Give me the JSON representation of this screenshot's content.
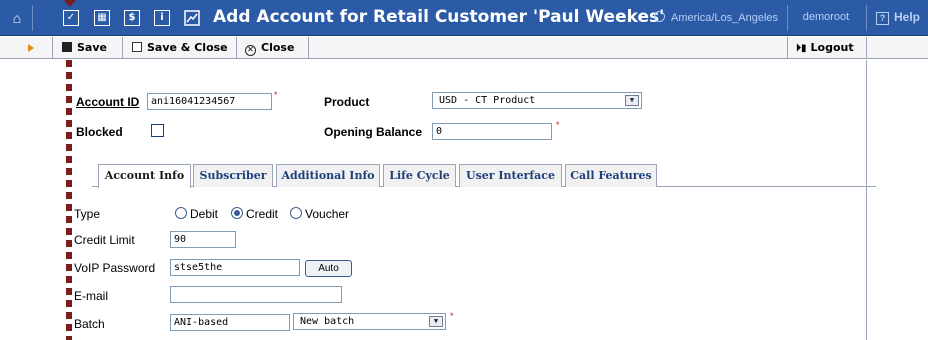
{
  "header": {
    "title": "Add Account for Retail Customer 'Paul Weekes'",
    "timezone": "America/Los_Angeles",
    "user": "demoroot",
    "help_label": "Help",
    "help_glyph": "?",
    "icons": [
      "home-icon",
      "checkbox-icon",
      "grid-icon",
      "dollar-icon",
      "info-icon",
      "chart-icon"
    ],
    "color": "#2b5aa6"
  },
  "toolbar": {
    "save_label": "Save",
    "save_close_label": "Save & Close",
    "close_label": "Close",
    "logout_label": "Logout"
  },
  "form": {
    "account_id_label": "Account ID",
    "account_id_value": "ani16041234567",
    "product_label": "Product",
    "product_value": "USD - CT Product",
    "blocked_label": "Blocked",
    "opening_balance_label": "Opening Balance",
    "opening_balance_value": "0"
  },
  "tabs": [
    {
      "label": "Account Info",
      "active": true
    },
    {
      "label": "Subscriber",
      "active": false
    },
    {
      "label": "Additional Info",
      "active": false
    },
    {
      "label": "Life Cycle",
      "active": false
    },
    {
      "label": "User Interface",
      "active": false
    },
    {
      "label": "Call Features",
      "active": false
    }
  ],
  "account_info": {
    "type_label": "Type",
    "type_options": [
      "Debit",
      "Credit",
      "Voucher"
    ],
    "type_selected": "Credit",
    "credit_limit_label": "Credit Limit",
    "credit_limit_value": "90",
    "voip_password_label": "VoIP Password",
    "voip_password_value": "stse5the",
    "auto_label": "Auto",
    "email_label": "E-mail",
    "email_value": "",
    "batch_label": "Batch",
    "batch_value": "ANI-based",
    "batch_select_value": "New batch"
  },
  "required_marker": "*"
}
